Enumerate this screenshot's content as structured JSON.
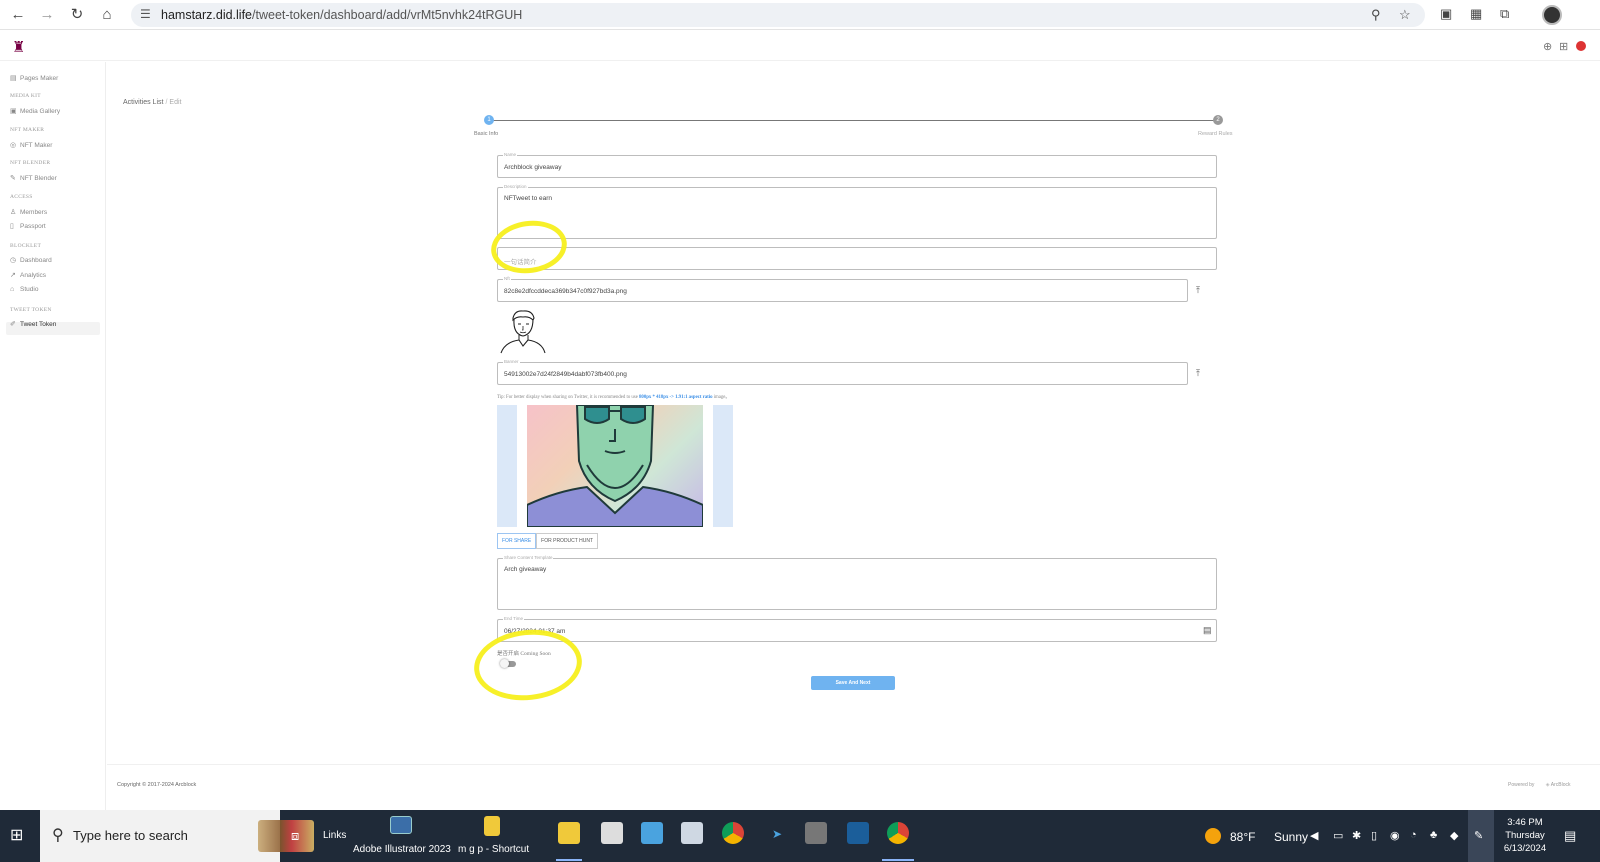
{
  "browser": {
    "url_host": "hamstarz.did.life",
    "url_path": "/tweet-token/dashboard/add/vrMt5nvhk24tRGUH"
  },
  "sidebar": {
    "items": [
      {
        "type": "item",
        "label": "Pages Maker",
        "icon": "pages-icon"
      },
      {
        "type": "section",
        "label": "MEDIA KIT"
      },
      {
        "type": "item",
        "label": "Media Gallery",
        "icon": "gallery-icon"
      },
      {
        "type": "section",
        "label": "NFT MAKER"
      },
      {
        "type": "item",
        "label": "NFT Maker",
        "icon": "nft-maker-icon"
      },
      {
        "type": "section",
        "label": "NFT BLENDER"
      },
      {
        "type": "item",
        "label": "NFT Blender",
        "icon": "pencil-icon"
      },
      {
        "type": "section",
        "label": "ACCESS"
      },
      {
        "type": "item",
        "label": "Members",
        "icon": "user-icon"
      },
      {
        "type": "item",
        "label": "Passport",
        "icon": "passport-icon"
      },
      {
        "type": "section",
        "label": "BLOCKLET"
      },
      {
        "type": "item",
        "label": "Dashboard",
        "icon": "dashboard-icon"
      },
      {
        "type": "item",
        "label": "Analytics",
        "icon": "analytics-icon"
      },
      {
        "type": "item",
        "label": "Studio",
        "icon": "studio-icon"
      },
      {
        "type": "section",
        "label": "TWEET TOKEN"
      },
      {
        "type": "item",
        "label": "Tweet Token",
        "icon": "tweet-token-icon",
        "active": true
      }
    ]
  },
  "breadcrumb": {
    "root": "Activities List",
    "sep": "/",
    "current": "Edit"
  },
  "stepper": {
    "steps": [
      {
        "label": "Basic Info",
        "active": true
      },
      {
        "label": "Reward Rules",
        "active": false
      }
    ]
  },
  "form": {
    "name": {
      "label": "Name",
      "value": "Archblock giveaway"
    },
    "description": {
      "label": "Description",
      "value": "NFTweet to earn"
    },
    "short_desc": {
      "placeholder": "一句话简介"
    },
    "nft": {
      "label": "Nft",
      "value": "82c8e2dfccddeca369b347c0f927bd3a.png"
    },
    "banner": {
      "label": "Banner",
      "value": "54913002e7d24f2849b4dabf073fb400.png"
    },
    "tip": {
      "prefix": "Tip: For better display when sharing on Twitter, it is recommended to use ",
      "highlight": "800px * 418px -> 1.91:1 aspect ratio",
      "suffix": " image。"
    },
    "tabs": [
      "FOR SHARE",
      "FOR PRODUCT HUNT"
    ],
    "share_template": {
      "label": "Share Content Template",
      "value": "Arch giveaway"
    },
    "end_time": {
      "label": "End Time",
      "value": "06/27/2024 01:37 am"
    },
    "toggle_label": "是否开启 Coming Soon",
    "save_button": "Save And Next"
  },
  "footer": {
    "copyright": "Copyright © 2017-2024  Arcblock",
    "powered_by": "Powered by",
    "powered_name": "ArcBlock"
  },
  "taskbar": {
    "search_placeholder": "Type here to search",
    "links": "Links",
    "app_illustrator": "Adobe Illustrator 2023",
    "app_shortcut": "m g p - Shortcut",
    "weather_temp": "88°F",
    "weather_cond": "Sunny",
    "time": "3:46 PM",
    "day": "Thursday",
    "date": "6/13/2024"
  },
  "colors": {
    "accent": "#3a8ee6",
    "save_button": "#6fb3f0",
    "annotation": "#f7ef1e",
    "taskbar": "#1f2a38"
  }
}
